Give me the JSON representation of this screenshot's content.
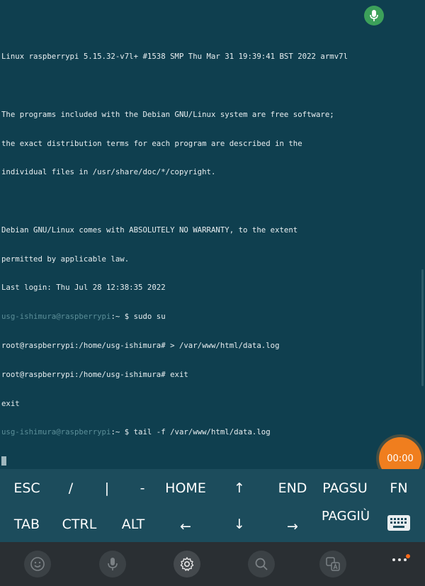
{
  "terminal": {
    "lines": [
      {
        "text": "Linux raspberrypi 5.15.32-v7l+ #1538 SMP Thu Mar 31 19:39:41 BST 2022 armv7l"
      },
      {
        "text": ""
      },
      {
        "text": "The programs included with the Debian GNU/Linux system are free software;"
      },
      {
        "text": "the exact distribution terms for each program are described in the"
      },
      {
        "text": "individual files in /usr/share/doc/*/copyright."
      },
      {
        "text": ""
      },
      {
        "text": "Debian GNU/Linux comes with ABSOLUTELY NO WARRANTY, to the extent"
      },
      {
        "text": "permitted by applicable law."
      },
      {
        "text": "Last login: Thu Jul 28 12:38:35 2022"
      },
      {
        "prompt": "usg-ishimura@raspberrypi",
        "text": ":~ $ sudo su"
      },
      {
        "text": "root@raspberrypi:/home/usg-ishimura# > /var/www/html/data.log"
      },
      {
        "text": "root@raspberrypi:/home/usg-ishimura# exit"
      },
      {
        "text": "exit"
      },
      {
        "prompt": "usg-ishimura@raspberrypi",
        "text": ":~ $ tail -f /var/www/html/data.log"
      }
    ]
  },
  "recording": {
    "timer": "00:00"
  },
  "keyboard": {
    "row1": [
      "ESC",
      "/",
      "|",
      "-",
      "HOME",
      "↑",
      "END",
      "PAGSU",
      "FN"
    ],
    "row2": [
      "TAB",
      "CTRL",
      "ALT",
      "←",
      "↓",
      "→",
      "PAGGIÙ"
    ]
  },
  "navbar": {
    "icons": [
      "emoji-icon",
      "mic-icon",
      "settings-icon",
      "search-icon",
      "translate-icon",
      "more-icon"
    ]
  },
  "colors": {
    "terminal_bg": "#0f3f4f",
    "keys_bg": "#1c4c5c",
    "navbar_bg": "#2a2f33",
    "record_accent": "#f07e1e",
    "mic_accent": "#3ca05a"
  }
}
